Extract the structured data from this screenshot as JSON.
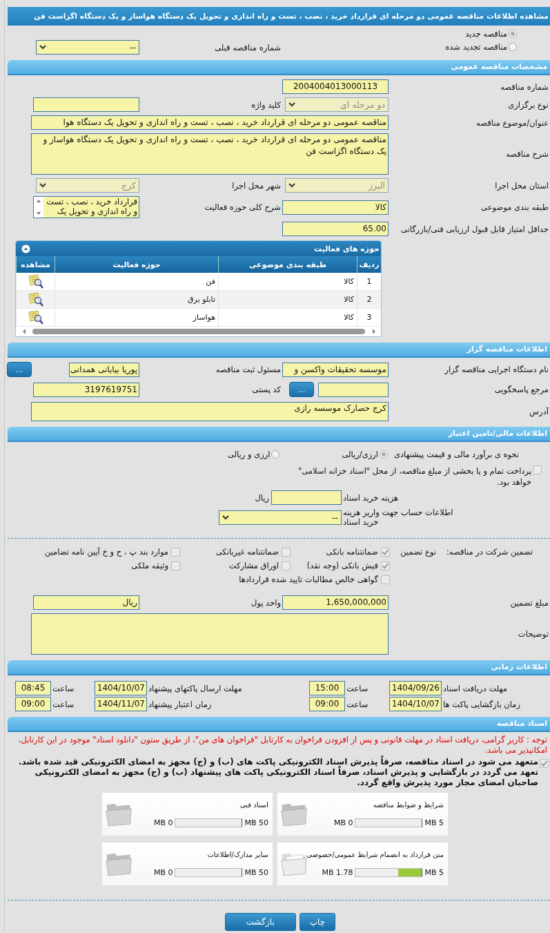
{
  "title": "مشاهده اطلاعات مناقصه عمومی دو مرحله ای قرارداد خرید ، نصب ، تست و راه اندازی و تحویل یک دستگاه هواساز و یک دستگاه اگزاست فن",
  "tender_type": [
    {
      "label": "مناقصه جدید",
      "selected": true
    },
    {
      "label": "مناقصه تجدید شده",
      "selected": false
    }
  ],
  "previous_tender": {
    "label": "شماره مناقصه قبلی",
    "value": "--"
  },
  "general": {
    "header": "مشخصات مناقصه عمومی",
    "rows": [
      [
        {
          "kind": "code",
          "label": "شماره مناقصه",
          "value": "2004004013000113"
        }
      ],
      [
        {
          "kind": "select",
          "label": "نوع برگزاری",
          "value": "دو مرحله ای",
          "disabled": true
        },
        {
          "kind": "text",
          "label": "کلید واژه"
        }
      ],
      [
        {
          "kind": "line",
          "label": "عنوان/موضوع مناقصه",
          "value": "مناقصه عمومی دو مرحله ای  قرارداد خرید ، نصب ، تست و راه اندازی و تحویل  یک دستگاه هوا"
        }
      ],
      [
        {
          "kind": "textarea",
          "label": "شرح مناقصه",
          "value": "مناقصه عمومی دو مرحله ای قرارداد خرید ، نصب ، تست و راه اندازی و تحویل  یک دستگاه هواساز و یک دستگاه اگزاست فن"
        }
      ],
      [
        {
          "kind": "select",
          "label": "استان محل اجرا",
          "value": "البرز",
          "disabled": true
        },
        {
          "kind": "select",
          "label": "شهر محل اجرا",
          "value": "کرج",
          "disabled": true
        }
      ],
      [
        {
          "kind": "text",
          "label": "طبقه بندی موضوعی",
          "value": "کالا"
        },
        {
          "kind": "scroll",
          "label": "شرح کلی حوزه فعالیت",
          "value": "قرارداد خرید ، نصب ، تست و راه اندازی و تحویل  یک"
        }
      ],
      [
        {
          "kind": "text",
          "label": "حداقل امتیاز قابل قبول ارزیابی فنی/بازرگانی",
          "value": "65.00"
        }
      ]
    ]
  },
  "activities": {
    "title": "حوزه های فعالیت",
    "columns": [
      "ردیف",
      "طبقه بندی موضوعی",
      "حوزه فعالیت",
      "مشاهده"
    ],
    "rows": [
      [
        "1",
        "کالا",
        "فن"
      ],
      [
        "2",
        "کالا",
        "تابلو برق"
      ],
      [
        "3",
        "کالا",
        "هواساز"
      ]
    ]
  },
  "organizer": {
    "header": "اطلاعات مناقصه گزار",
    "rows": [
      [
        {
          "kind": "text",
          "label": "نام دستگاه اجرایی مناقصه گزار",
          "value": "موسسه تحقیقات واکسن و"
        },
        {
          "kind": "text",
          "label": "مسئول ثبت مناقصه",
          "value": "پوریا بیابانی همدانی",
          "button": "..."
        }
      ],
      [
        {
          "kind": "text",
          "label": "مرجع پاسخگویی",
          "button": "..."
        },
        {
          "kind": "text",
          "label": "کد پستی",
          "value": "3197619751"
        }
      ],
      [
        {
          "kind": "memo",
          "label": "آدرس",
          "value": "کرج حصارک موسسه رازی"
        }
      ]
    ]
  },
  "finance": {
    "header": "اطلاعات مالی/تامین اعتبار",
    "estimate": {
      "label": "نحوه ی برآورد مالی و قیمت پیشنهادی",
      "options": [
        {
          "label": "ارزی/ریالی",
          "selected": true
        },
        {
          "label": "ارزی و ریالی",
          "selected": false
        }
      ]
    },
    "treasury": {
      "checked": false,
      "text": "پرداخت تمام و یا بخشی از مبلغ مناقصه، از محل \"اسناد خزانه اسلامی\" خواهد بود."
    },
    "doc_cost": {
      "label": "هزینه خرید اسناد",
      "unit": "ریال"
    },
    "account": {
      "label": "اطلاعات حساب جهت واریز هزینه خرید اسناد",
      "value": "--"
    }
  },
  "guarantee": {
    "label": "تضمین شرکت در مناقصه:",
    "type_label": "نوع تضمین",
    "options": [
      {
        "label": "ضمانتنامه بانکی",
        "checked": true
      },
      {
        "label": "ضمانتنامه غیربانکی",
        "checked": false
      },
      {
        "label": "موارد بند پ ، ح و خ آیین نامه تضامین",
        "checked": false
      },
      {
        "label": "فیش بانکی (وجه نقد)",
        "checked": true
      },
      {
        "label": "اوراق مشارکت",
        "checked": false
      },
      {
        "label": "وثیقه ملکی",
        "checked": false
      },
      {
        "label": "گواهی خالص مطالبات تایید شده قراردادها",
        "checked": false
      }
    ],
    "rows": [
      [
        {
          "kind": "text",
          "label": "مبلغ تضمین",
          "value": "1,650,000,000"
        },
        {
          "kind": "text",
          "label": "واحد پول",
          "value": "ریال"
        }
      ],
      [
        {
          "kind": "textarea",
          "label": "توضیحات"
        }
      ]
    ]
  },
  "timing": {
    "header": "اطلاعات زمانی",
    "rows": [
      [
        {
          "label": "مهلت دریافت اسناد",
          "date": "1404/09/26",
          "time_label": "ساعت",
          "time": "15:00"
        },
        {
          "label": "مهلت ارسال پاکتهای پیشنهاد",
          "date": "1404/10/07",
          "time_label": "ساعت",
          "time": "08:45"
        }
      ],
      [
        {
          "label": "زمان بازگشایی پاکت ها",
          "date": "1404/10/07",
          "time_label": "ساعت",
          "time": "09:00"
        },
        {
          "label": "زمان اعتبار پیشنهاد",
          "date": "1404/11/07",
          "time_label": "ساعت",
          "time": "09:00"
        }
      ]
    ]
  },
  "documents": {
    "header": "اسناد مناقصه",
    "notice": "توجه : کاربر گرامی، دریافت اسناد در مهلت قانونی و پس از افزودن فراخوان به کارتابل \"فراخوان های من\"، از طریق ستون \"دانلود اسناد\" موجود در این کارتابل، امکانپذیر می باشد.",
    "commitment": {
      "checked": true,
      "text": "متعهد می شود در اسناد مناقصه، صرفاً پذیرش اسناد الکترونیکی پاکت های (ب) و (ج) مجهز به امضای الکترونیکی قید شده باشد. تعهد می گردد در بازگشایی و پذیرش اسناد، صرفاً اسناد الکترونیکی پاکت های پیشنهاد (ب) و (ج) مجهز به امضای الکترونیکی صاحبان امضای مجاز مورد پذیرش واقع گردد."
    },
    "files": [
      {
        "title": "شرایط و ضوابط مناقصه",
        "max": "5 MB",
        "used": "0 MB",
        "level": 0
      },
      {
        "title": "اسناد فنی",
        "max": "50 MB",
        "used": "0 MB",
        "level": 0
      },
      {
        "title": "متن قرارداد به انضمام شرایط عمومی/خصوصی",
        "max": "5 MB",
        "used": "1.78 MB",
        "level": 0.356
      },
      {
        "title": "سایر مدارک/اطلاعات",
        "max": "50 MB",
        "used": "0 MB",
        "level": 0
      }
    ]
  },
  "buttons": [
    {
      "label": "چاپ"
    },
    {
      "label": "بازگشت"
    }
  ]
}
